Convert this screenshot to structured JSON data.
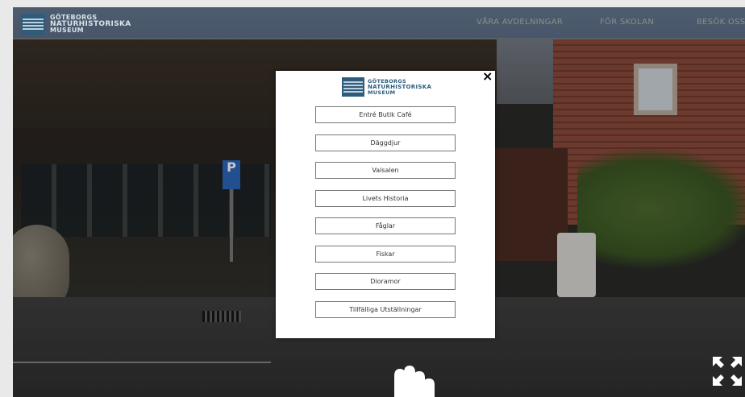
{
  "header": {
    "logo_line1": "GÖTEBORGS",
    "logo_line2": "NATURHISTORISKA",
    "logo_line3": "MUSEUM",
    "nav": [
      "VÅRA AVDELNINGAR",
      "FÖR SKOLAN",
      "BESÖK OSS"
    ]
  },
  "modal": {
    "logo_line1": "GÖTEBORGS",
    "logo_line2": "NATURHISTORISKA",
    "logo_line3": "MUSEUM",
    "close_symbol": "×",
    "items": [
      "Entré Butik Café",
      "Däggdjur",
      "Valsalen",
      "Livets Historia",
      "Fåglar",
      "Fiskar",
      "Dioramor",
      "Tillfälliga Utställningar"
    ]
  },
  "scene": {
    "parking_sign": "P"
  },
  "icons": {
    "drag": "hand-pointer-icon",
    "fullscreen": "fullscreen-icon"
  }
}
